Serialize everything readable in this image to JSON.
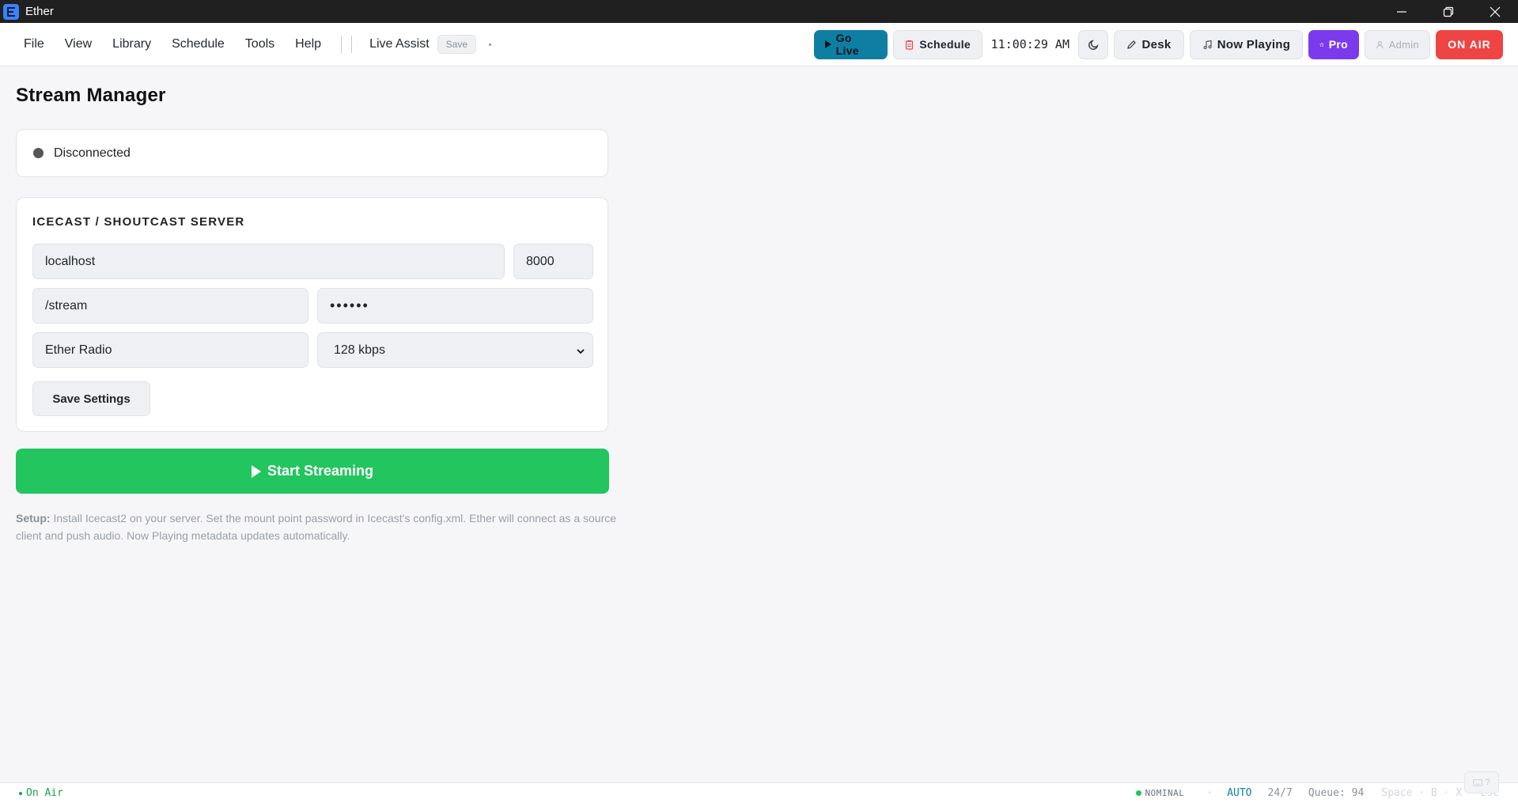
{
  "window": {
    "title": "Ether"
  },
  "menu": [
    "File",
    "View",
    "Library",
    "Schedule",
    "Tools",
    "Help"
  ],
  "toolbar": {
    "live_assist": "Live Assist",
    "save": "Save",
    "go_live": "Go Live",
    "schedule": "Schedule",
    "clock": "11:00:29 AM",
    "desk": "Desk",
    "now_playing": "Now Playing",
    "pro": "Pro",
    "admin": "Admin",
    "on_air": "ON AIR"
  },
  "page": {
    "title": "Stream Manager"
  },
  "connection": {
    "status": "Disconnected"
  },
  "server": {
    "section_title": "ICECAST / SHOUTCAST SERVER",
    "host": "localhost",
    "port": "8000",
    "mount": "/stream",
    "password": "••••••",
    "station_name": "Ether Radio",
    "bitrate": "128 kbps",
    "save_label": "Save Settings"
  },
  "stream_button": "Start Streaming",
  "setup": {
    "label": "Setup:",
    "text": " Install Icecast2 on your server. Set the mount point password in Icecast's config.xml. Ether will connect as a source client and push audio. Now Playing metadata updates automatically."
  },
  "statusbar": {
    "on_air": "On Air",
    "health": "NOMINAL",
    "separator": "·",
    "mode": "AUTO",
    "hours": "24/7",
    "queue": "Queue: 94",
    "shortcuts": "Space · B · X · Esc",
    "help_badge": "?"
  },
  "colors": {
    "go_live": "#0e7fa3",
    "pro": "#7c3aed",
    "on_air": "#ef4444",
    "stream": "#22c55e",
    "status_disconnected": "#555555"
  }
}
